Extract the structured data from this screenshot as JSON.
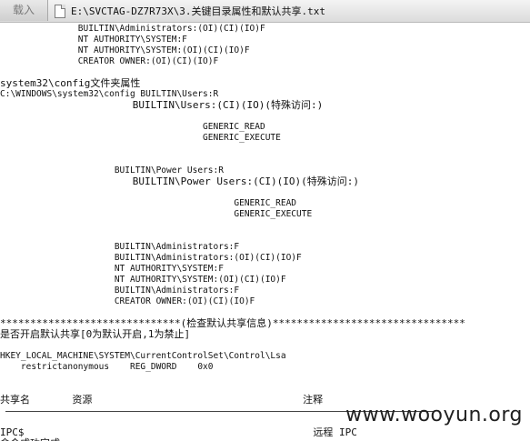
{
  "toolbar": {
    "load_label": "载入",
    "file_path": "E:\\SVCTAG-DZ7R73X\\3.关键目录属性和默认共享.txt"
  },
  "document": {
    "lines": [
      "               BUILTIN\\Administrators:(OI)(CI)(IO)F",
      "               NT AUTHORITY\\SYSTEM:F",
      "               NT AUTHORITY\\SYSTEM:(OI)(CI)(IO)F",
      "               CREATOR OWNER:(OI)(CI)(IO)F",
      "",
      "system32\\config文件夹属性",
      "C:\\WINDOWS\\system32\\config BUILTIN\\Users:R",
      "                      BUILTIN\\Users:(CI)(IO)(特殊访问:)",
      "",
      "                                       GENERIC_READ",
      "                                       GENERIC_EXECUTE",
      "",
      "",
      "                      BUILTIN\\Power Users:R",
      "                      BUILTIN\\Power Users:(CI)(IO)(特殊访问:)",
      "",
      "                                             GENERIC_READ",
      "                                             GENERIC_EXECUTE",
      "",
      "",
      "                      BUILTIN\\Administrators:F",
      "                      BUILTIN\\Administrators:(OI)(CI)(IO)F",
      "                      NT AUTHORITY\\SYSTEM:F",
      "                      NT AUTHORITY\\SYSTEM:(OI)(CI)(IO)F",
      "                      BUILTIN\\Administrators:F",
      "                      CREATOR OWNER:(OI)(CI)(IO)F",
      "",
      "******************************(检查默认共享信息)********************************",
      "是否开启默认共享[0为默认开启,1为禁止]",
      "",
      "HKEY_LOCAL_MACHINE\\SYSTEM\\CurrentControlSet\\Control\\Lsa",
      "    restrictanonymous    REG_DWORD    0x0",
      "",
      "",
      "共享名       资源                                   注释",
      "",
      "",
      "IPC$                                                远程 IPC",
      "命令成功完成。"
    ]
  },
  "watermark": "www.wooyun.org"
}
